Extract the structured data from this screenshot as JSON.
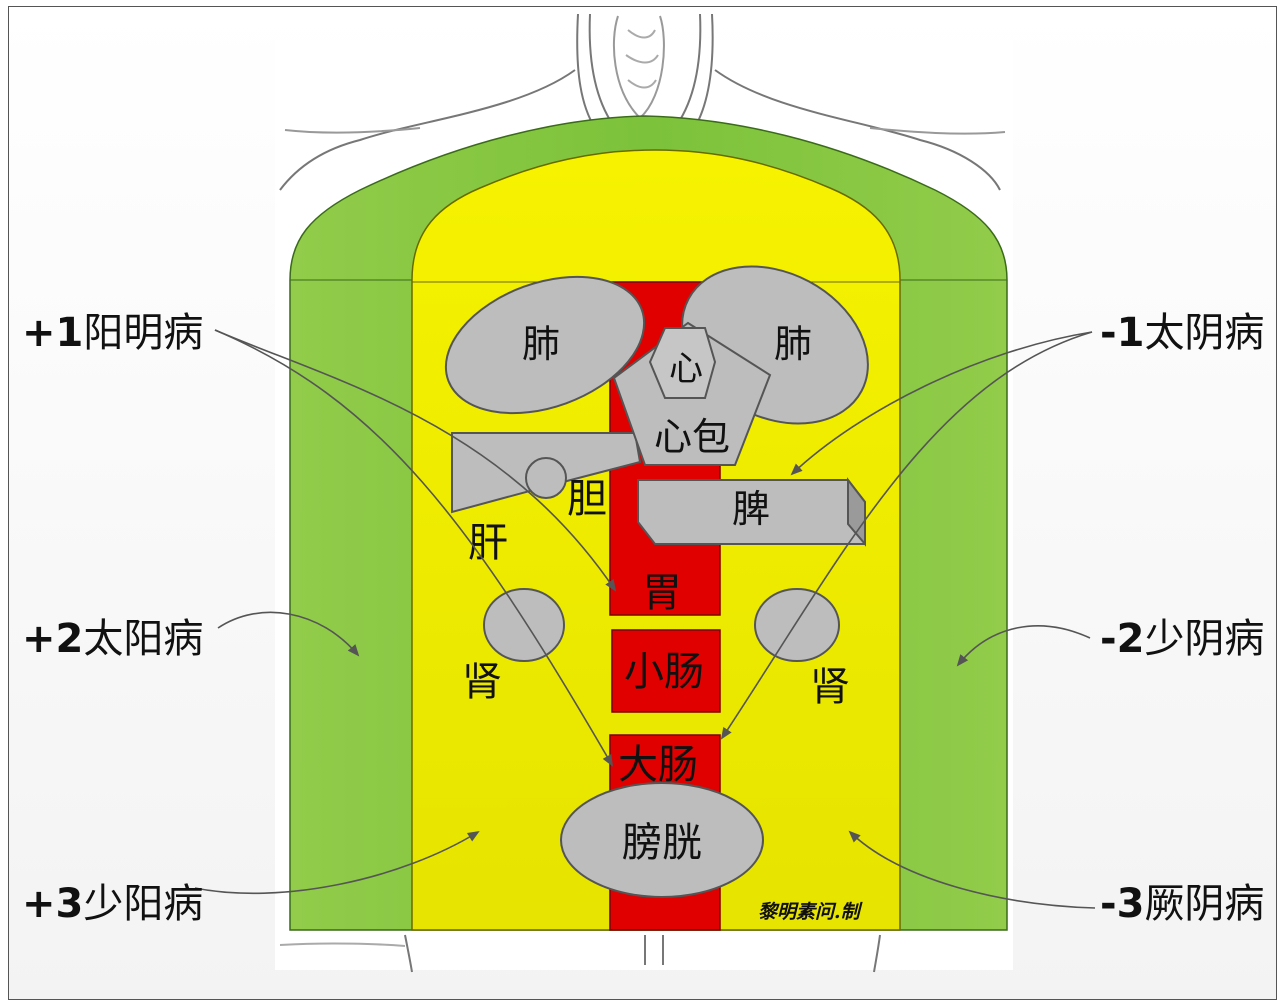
{
  "organs": {
    "lung_left": "肺",
    "lung_right": "肺",
    "heart": "心",
    "pericardium": "心包",
    "gallbladder": "胆",
    "liver": "肝",
    "spleen": "脾",
    "stomach": "胃",
    "kidney_left": "肾",
    "kidney_right": "肾",
    "small_intestine": "小肠",
    "large_intestine": "大肠",
    "bladder": "膀胱"
  },
  "labels": {
    "yangming": {
      "sign": "+1",
      "text": "阳明病"
    },
    "taiyang": {
      "sign": "+2",
      "text": "太阳病"
    },
    "shaoyang": {
      "sign": "+3",
      "text": "少阳病"
    },
    "taiyin": {
      "sign": "-1",
      "text": "太阴病"
    },
    "shaoyin": {
      "sign": "-2",
      "text": "少阴病"
    },
    "jueyin": {
      "sign": "-3",
      "text": "厥阴病"
    }
  },
  "signature": "黎明素问.制",
  "colors": {
    "outer_layer": "#8cc63f",
    "middle_layer": "#f2ef00",
    "core_channel": "#e00000",
    "organ": "#bdbdbd",
    "arrow": "#555555"
  }
}
